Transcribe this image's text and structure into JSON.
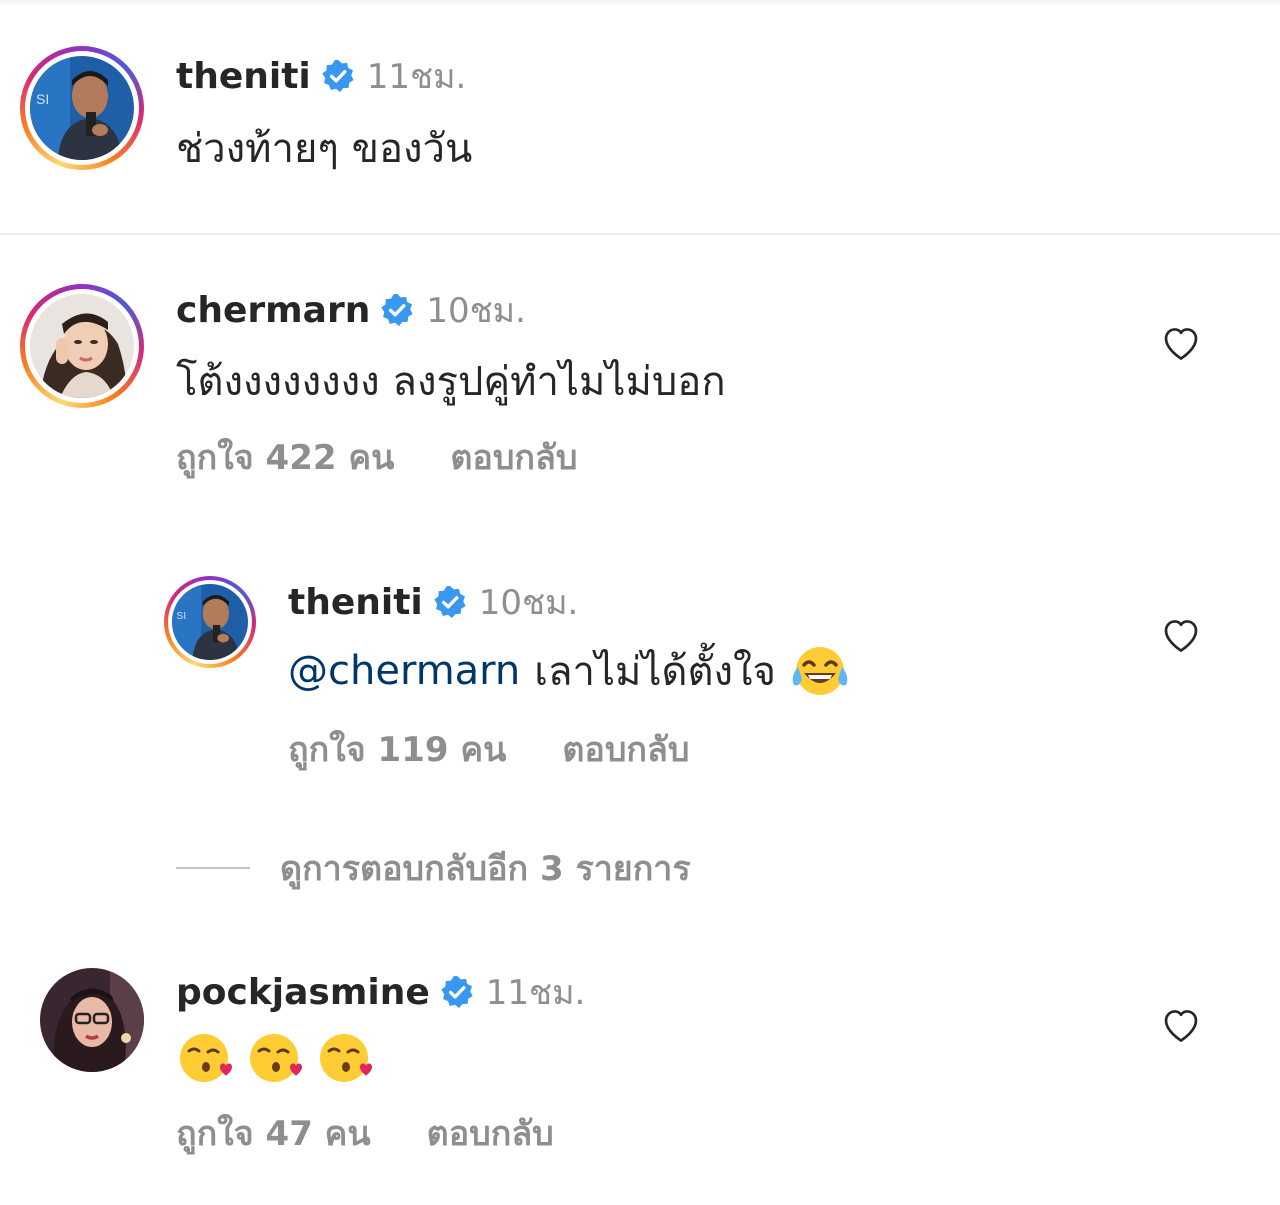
{
  "caption": {
    "username": "theniti",
    "verified": true,
    "time": "11ชม.",
    "text": "ช่วงท้ายๆ ของวัน"
  },
  "comments": [
    {
      "username": "chermarn",
      "verified": true,
      "time": "10ชม.",
      "text": "โต้งงงงงงงง ลงรูปคู่ทำไมไม่บอก",
      "likes_label": "ถูกใจ 422 คน",
      "reply_label": "ตอบกลับ",
      "replies": [
        {
          "username": "theniti",
          "verified": true,
          "time": "10ชม.",
          "mention": "@chermarn",
          "text": "เลาไม่ได้ตั้งใจ",
          "emoji": "face-with-tears-of-joy",
          "likes_label": "ถูกใจ 119 คน",
          "reply_label": "ตอบกลับ"
        }
      ],
      "view_more_replies_label": "ดูการตอบกลับอีก 3 รายการ"
    },
    {
      "username": "pockjasmine",
      "verified": true,
      "time": "11ชม.",
      "emojis": [
        "face-blowing-a-kiss",
        "face-blowing-a-kiss",
        "face-blowing-a-kiss"
      ],
      "likes_label": "ถูกใจ 47 คน",
      "reply_label": "ตอบกลับ"
    }
  ],
  "colors": {
    "verified_badge": "#3897f0",
    "mention": "#00376b",
    "secondary_text": "#8e8e8e",
    "primary_text": "#262626"
  },
  "icons": {
    "like": "heart-outline-icon",
    "verified": "verified-badge-icon"
  }
}
